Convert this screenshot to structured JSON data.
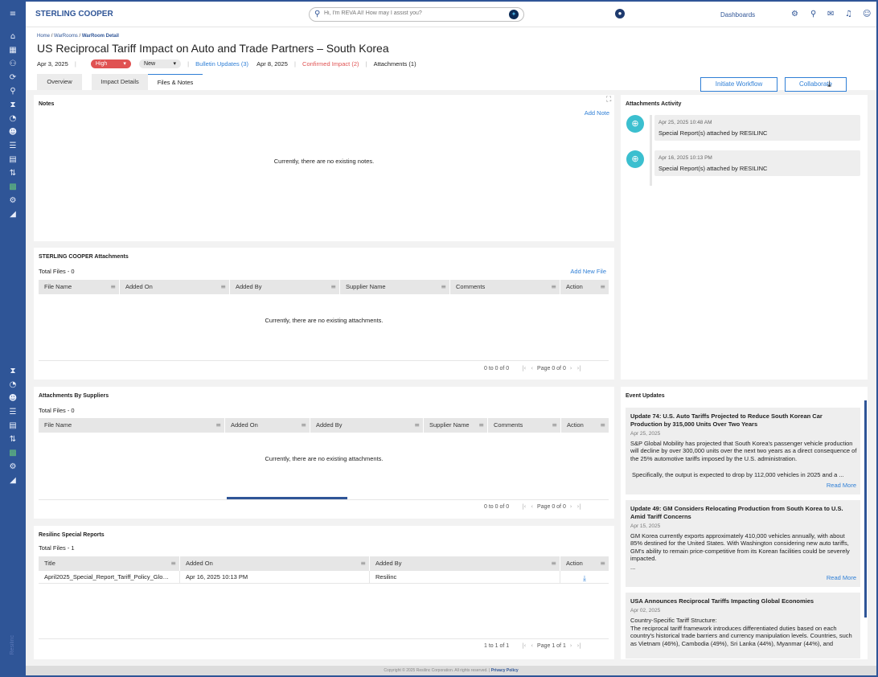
{
  "topbar": {
    "brand": "STERLING COOPER",
    "search_placeholder": "Hi, I'm REVA AI! How may I assist you?",
    "dashboards": "Dashboards"
  },
  "breadcrumb": [
    "Home",
    "WarRooms",
    "WarRoom Detail"
  ],
  "page": {
    "title": "US Reciprocal Tariff Impact on Auto and Trade Partners – South Korea",
    "date": "Apr 3, 2025",
    "severity": "High",
    "status": "New",
    "bulletin_updates": "Bulletin Updates (3)",
    "bulletin_date": "Apr 8, 2025",
    "confirmed_impact": "Confirmed Impact (2)",
    "attachments": "Attachments (1)"
  },
  "tabs": [
    "Overview",
    "Impact Details",
    "Files & Notes"
  ],
  "actions": {
    "initiate": "Initiate Workflow",
    "collaborate": "Collaborate"
  },
  "notes": {
    "title": "Notes",
    "add": "Add Note",
    "empty": "Currently, there are no existing notes."
  },
  "sc_attachments": {
    "title": "STERLING COOPER Attachments",
    "total": "Total Files - 0",
    "add": "Add New File",
    "columns": [
      "File Name",
      "Added On",
      "Added By",
      "Supplier Name",
      "Comments",
      "Action"
    ],
    "empty": "Currently, there are no existing attachments.",
    "pager_count": "0 to 0 of 0",
    "pager_page": "Page 0 of 0"
  },
  "supplier_attachments": {
    "title": "Attachments By Suppliers",
    "total": "Total Files - 0",
    "columns": [
      "File Name",
      "Added On",
      "Added By",
      "Supplier Name",
      "Comments",
      "Action"
    ],
    "empty": "Currently, there are no existing attachments.",
    "pager_count": "0 to 0 of 0",
    "pager_page": "Page 0 of 0"
  },
  "special_reports": {
    "title": "Resilinc Special Reports",
    "total": "Total Files - 1",
    "columns": [
      "Title",
      "Added On",
      "Added By",
      "Action"
    ],
    "rows": [
      {
        "title": "April2025_Special_Report_Tariff_Policy_Glo…",
        "added_on": "Apr 16, 2025 10:13 PM",
        "added_by": "Resilinc"
      }
    ],
    "pager_count": "1 to 1 of 1",
    "pager_page": "Page 1 of 1"
  },
  "activity": {
    "title": "Attachments Activity",
    "items": [
      {
        "date": "Apr 25, 2025 10:48 AM",
        "text": "Special Report(s) attached by RESILINC"
      },
      {
        "date": "Apr 16, 2025 10:13 PM",
        "text": "Special Report(s) attached by RESILINC"
      }
    ]
  },
  "events": {
    "title": "Event Updates",
    "read_more": "Read More",
    "items": [
      {
        "title": "Update 74: U.S. Auto Tariffs Projected to Reduce South Korean Car Production by 315,000 Units Over Two Years",
        "date": "Apr 25, 2025",
        "body": "S&P Global Mobility has projected that South Korea's passenger vehicle production will decline by over 300,000 units over the next two years as a direct consequence of the 25% automotive tariffs imposed by the U.S. administration.",
        "body2": "Specifically, the output is expected to drop by 112,000 vehicles in 2025 and a ..."
      },
      {
        "title": "Update 49: GM Considers Relocating Production from South Korea to U.S. Amid Tariff Concerns",
        "date": "Apr 15, 2025",
        "body": "GM Korea currently exports approximately 410,000 vehicles annually, with about 85% destined for the United States. With Washington considering new auto tariffs, GM's ability to remain price-competitive from its Korean facilities could be severely impacted.",
        "body2": "..."
      },
      {
        "title": "USA Announces Reciprocal Tariffs Impacting Global Economies",
        "date": "Apr 02, 2025",
        "body": "Country-Specific Tariff Structure:",
        "body2": "The reciprocal tariff framework introduces differentiated duties based on each country's historical trade barriers and currency manipulation levels. Countries, such as Vietnam (46%), Cambodia (49%), Sri Lanka (44%), Myanmar (44%), and"
      }
    ]
  },
  "footer": {
    "copy": "Copyright © 2025 Resilinc Corporation. All rights reserved. |",
    "policy": "Privacy Policy"
  },
  "sidebar_footer": "Resilinc",
  "icons": {
    "sidebar": [
      "menu-icon",
      "home-icon",
      "calendar-icon",
      "org-icon",
      "refresh-icon",
      "search-user-icon",
      "hourglass-icon",
      "gauge-icon",
      "users-icon",
      "list-icon",
      "clipboard-icon",
      "swap-icon",
      "grid-icon",
      "person-gear-icon",
      "chart-icon"
    ],
    "accent": "#2f5597",
    "link": "#2f7fd6",
    "danger": "#e05252"
  }
}
